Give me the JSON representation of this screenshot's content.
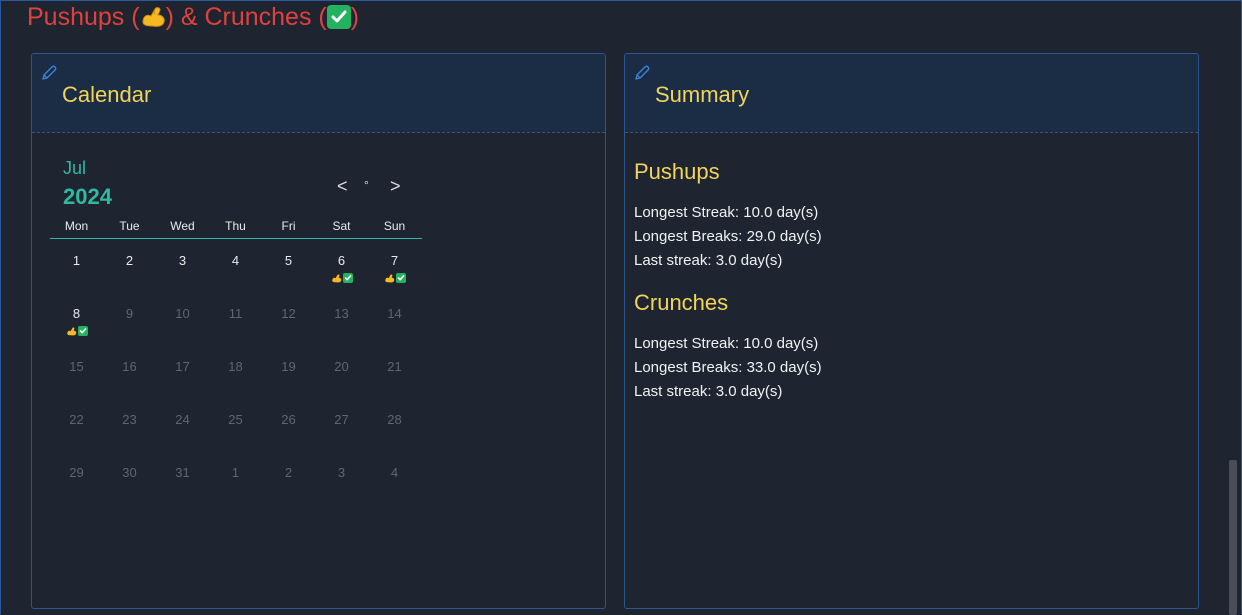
{
  "header": {
    "title_pre": "Pushups (",
    "title_mid": ") & Crunches (",
    "title_post": ")"
  },
  "icons": {
    "pushups": "flexed-biceps-icon",
    "crunches": "green-check-icon",
    "edit": "pencil-icon"
  },
  "colors": {
    "background": "#1e2530",
    "title": "#e0413d",
    "heading": "#f1d45a",
    "accent": "#2fb9a0",
    "panel_header": "#1b2c45",
    "check_green": "#23b35f"
  },
  "calendar": {
    "title": "Calendar",
    "month": "Jul",
    "year": "2024",
    "nav_prev": "<",
    "nav_today": "°",
    "nav_next": ">",
    "weekdays": [
      "Mon",
      "Tue",
      "Wed",
      "Thu",
      "Fri",
      "Sat",
      "Sun"
    ],
    "days": [
      {
        "label": "1",
        "dim": false,
        "pushups": false,
        "crunches": false
      },
      {
        "label": "2",
        "dim": false,
        "pushups": false,
        "crunches": false
      },
      {
        "label": "3",
        "dim": false,
        "pushups": false,
        "crunches": false
      },
      {
        "label": "4",
        "dim": false,
        "pushups": false,
        "crunches": false
      },
      {
        "label": "5",
        "dim": false,
        "pushups": false,
        "crunches": false
      },
      {
        "label": "6",
        "dim": false,
        "pushups": true,
        "crunches": true
      },
      {
        "label": "7",
        "dim": false,
        "pushups": true,
        "crunches": true
      },
      {
        "label": "8",
        "dim": false,
        "pushups": true,
        "crunches": true
      },
      {
        "label": "9",
        "dim": true
      },
      {
        "label": "10",
        "dim": true
      },
      {
        "label": "11",
        "dim": true
      },
      {
        "label": "12",
        "dim": true
      },
      {
        "label": "13",
        "dim": true
      },
      {
        "label": "14",
        "dim": true
      },
      {
        "label": "15",
        "dim": true
      },
      {
        "label": "16",
        "dim": true
      },
      {
        "label": "17",
        "dim": true
      },
      {
        "label": "18",
        "dim": true
      },
      {
        "label": "19",
        "dim": true
      },
      {
        "label": "20",
        "dim": true
      },
      {
        "label": "21",
        "dim": true
      },
      {
        "label": "22",
        "dim": true
      },
      {
        "label": "23",
        "dim": true
      },
      {
        "label": "24",
        "dim": true
      },
      {
        "label": "25",
        "dim": true
      },
      {
        "label": "26",
        "dim": true
      },
      {
        "label": "27",
        "dim": true
      },
      {
        "label": "28",
        "dim": true
      },
      {
        "label": "29",
        "dim": true
      },
      {
        "label": "30",
        "dim": true
      },
      {
        "label": "31",
        "dim": true
      },
      {
        "label": "1",
        "dim": true
      },
      {
        "label": "2",
        "dim": true
      },
      {
        "label": "3",
        "dim": true
      },
      {
        "label": "4",
        "dim": true
      }
    ]
  },
  "summary": {
    "title": "Summary",
    "sections": [
      {
        "heading": "Pushups",
        "lines": [
          "Longest Streak: 10.0 day(s)",
          "Longest Breaks: 29.0 day(s)",
          "Last streak: 3.0 day(s)"
        ]
      },
      {
        "heading": "Crunches",
        "lines": [
          "Longest Streak: 10.0 day(s)",
          "Longest Breaks: 33.0 day(s)",
          "Last streak: 3.0 day(s)"
        ]
      }
    ]
  }
}
